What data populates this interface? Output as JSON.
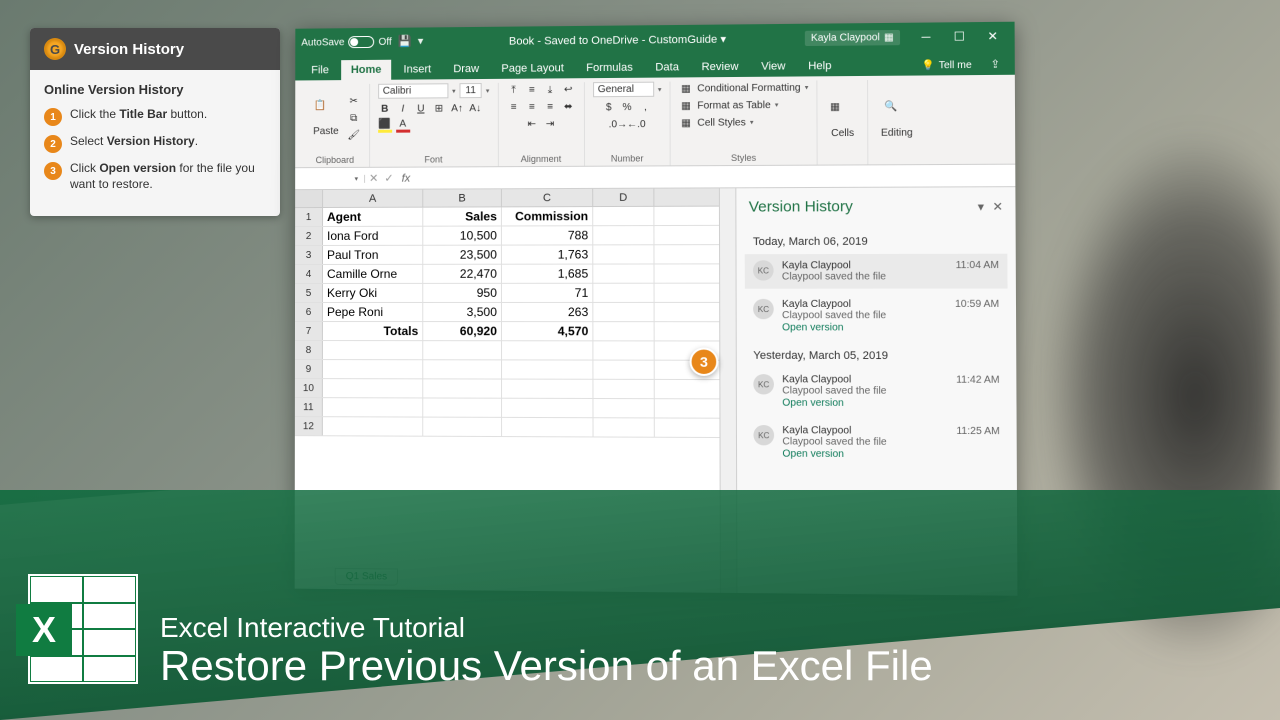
{
  "tutorial": {
    "header_title": "Version History",
    "subtitle": "Online Version History",
    "steps": [
      {
        "num": "1",
        "text_pre": "Click the ",
        "text_bold": "Title Bar",
        "text_post": " button."
      },
      {
        "num": "2",
        "text_pre": "Select ",
        "text_bold": "Version History",
        "text_post": "."
      },
      {
        "num": "3",
        "text_pre": "Click ",
        "text_bold": "Open version",
        "text_post": " for the file you want to restore."
      }
    ]
  },
  "excel": {
    "titlebar": {
      "autosave_label": "AutoSave",
      "autosave_state": "Off",
      "doc_title": "Book - Saved to OneDrive - CustomGuide ▾",
      "user_name": "Kayla Claypool"
    },
    "tabs": [
      "File",
      "Home",
      "Insert",
      "Draw",
      "Page Layout",
      "Formulas",
      "Data",
      "Review",
      "View",
      "Help"
    ],
    "active_tab": "Home",
    "tellme": "Tell me",
    "ribbon_groups": {
      "clipboard": "Clipboard",
      "paste": "Paste",
      "font": "Font",
      "font_name": "Calibri",
      "font_size": "11",
      "alignment": "Alignment",
      "number": "Number",
      "number_format": "General",
      "styles": "Styles",
      "cond_fmt": "Conditional Formatting",
      "fmt_table": "Format as Table",
      "cell_styles": "Cell Styles",
      "cells": "Cells",
      "editing": "Editing"
    },
    "formula_bar": {
      "name_box": "",
      "formula": ""
    },
    "columns": [
      "A",
      "B",
      "C",
      "D"
    ],
    "sheet": {
      "headers": [
        "Agent",
        "Sales",
        "Commission"
      ],
      "rows": [
        {
          "agent": "Iona Ford",
          "sales": "10,500",
          "comm": "788"
        },
        {
          "agent": "Paul Tron",
          "sales": "23,500",
          "comm": "1,763"
        },
        {
          "agent": "Camille Orne",
          "sales": "22,470",
          "comm": "1,685"
        },
        {
          "agent": "Kerry Oki",
          "sales": "950",
          "comm": "71"
        },
        {
          "agent": "Pepe Roni",
          "sales": "3,500",
          "comm": "263"
        }
      ],
      "totals": {
        "label": "Totals",
        "sales": "60,920",
        "comm": "4,570"
      },
      "tab_name": "Q1 Sales"
    },
    "version_history": {
      "title": "Version History",
      "groups": [
        {
          "date": "Today, March 06, 2019",
          "items": [
            {
              "initials": "KC",
              "name": "Kayla Claypool",
              "action": "Claypool saved the file",
              "time": "11:04 AM",
              "link": "",
              "selected": true
            },
            {
              "initials": "KC",
              "name": "Kayla Claypool",
              "action": "Claypool saved the file",
              "time": "10:59 AM",
              "link": "Open version",
              "selected": false
            }
          ]
        },
        {
          "date": "Yesterday, March 05, 2019",
          "items": [
            {
              "initials": "KC",
              "name": "Kayla Claypool",
              "action": "Claypool saved the file",
              "time": "11:42 AM",
              "link": "Open version",
              "selected": false
            },
            {
              "initials": "KC",
              "name": "Kayla Claypool",
              "action": "Claypool saved the file",
              "time": "11:25 AM",
              "link": "Open version",
              "selected": false
            }
          ]
        }
      ]
    }
  },
  "banner": {
    "line1": "Excel Interactive Tutorial",
    "line2": "Restore Previous Version of an Excel File",
    "logo_letter": "X"
  },
  "callout_num": "3"
}
